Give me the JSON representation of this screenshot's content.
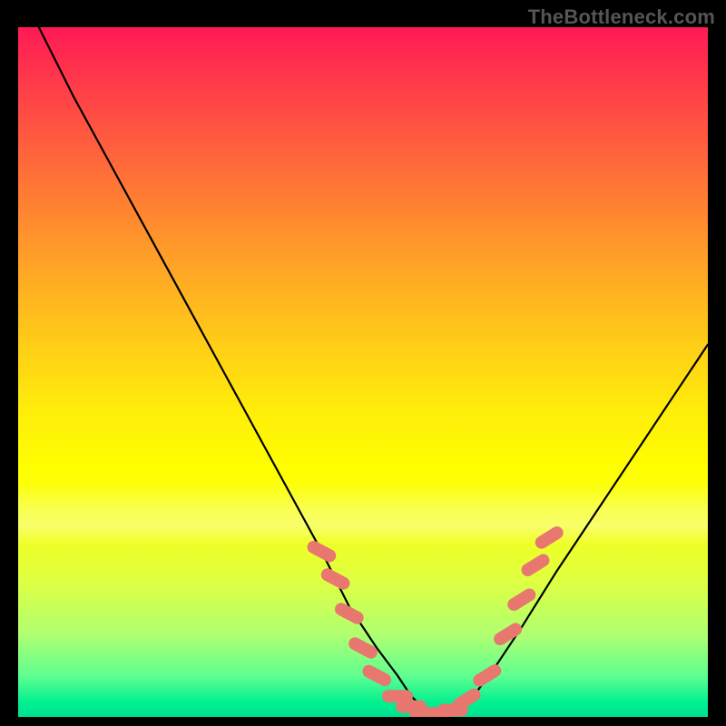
{
  "watermark": "TheBottleneck.com",
  "chart_data": {
    "type": "line",
    "title": "",
    "xlabel": "",
    "ylabel": "",
    "xlim": [
      0,
      100
    ],
    "ylim": [
      0,
      100
    ],
    "grid": false,
    "legend": false,
    "series": [
      {
        "name": "bottleneck-curve",
        "x": [
          3,
          8,
          14,
          20,
          26,
          32,
          38,
          44,
          48,
          52,
          55,
          57,
          59,
          61,
          63,
          66,
          69,
          73,
          78,
          84,
          90,
          96,
          100
        ],
        "y": [
          100,
          90,
          79,
          68,
          57,
          46,
          35,
          24,
          16,
          10,
          6,
          3,
          1,
          0,
          1,
          3,
          7,
          13,
          21,
          30,
          39,
          48,
          54
        ]
      }
    ],
    "markers": {
      "name": "highlighted-points",
      "color": "#e8776f",
      "points": [
        {
          "x": 44,
          "y": 24
        },
        {
          "x": 46,
          "y": 20
        },
        {
          "x": 48,
          "y": 15
        },
        {
          "x": 50,
          "y": 10
        },
        {
          "x": 52,
          "y": 6
        },
        {
          "x": 55,
          "y": 3
        },
        {
          "x": 57,
          "y": 1.5
        },
        {
          "x": 59,
          "y": 0.5
        },
        {
          "x": 61,
          "y": 0.5
        },
        {
          "x": 63,
          "y": 1
        },
        {
          "x": 65,
          "y": 2.5
        },
        {
          "x": 68,
          "y": 6
        },
        {
          "x": 71,
          "y": 12
        },
        {
          "x": 73,
          "y": 17
        },
        {
          "x": 75,
          "y": 22
        },
        {
          "x": 77,
          "y": 26
        }
      ]
    },
    "background_gradient": {
      "direction": "vertical",
      "stops": [
        {
          "pos": 0,
          "color": "#ff1a55"
        },
        {
          "pos": 50,
          "color": "#ffee0a"
        },
        {
          "pos": 100,
          "color": "#00e090"
        }
      ]
    }
  }
}
